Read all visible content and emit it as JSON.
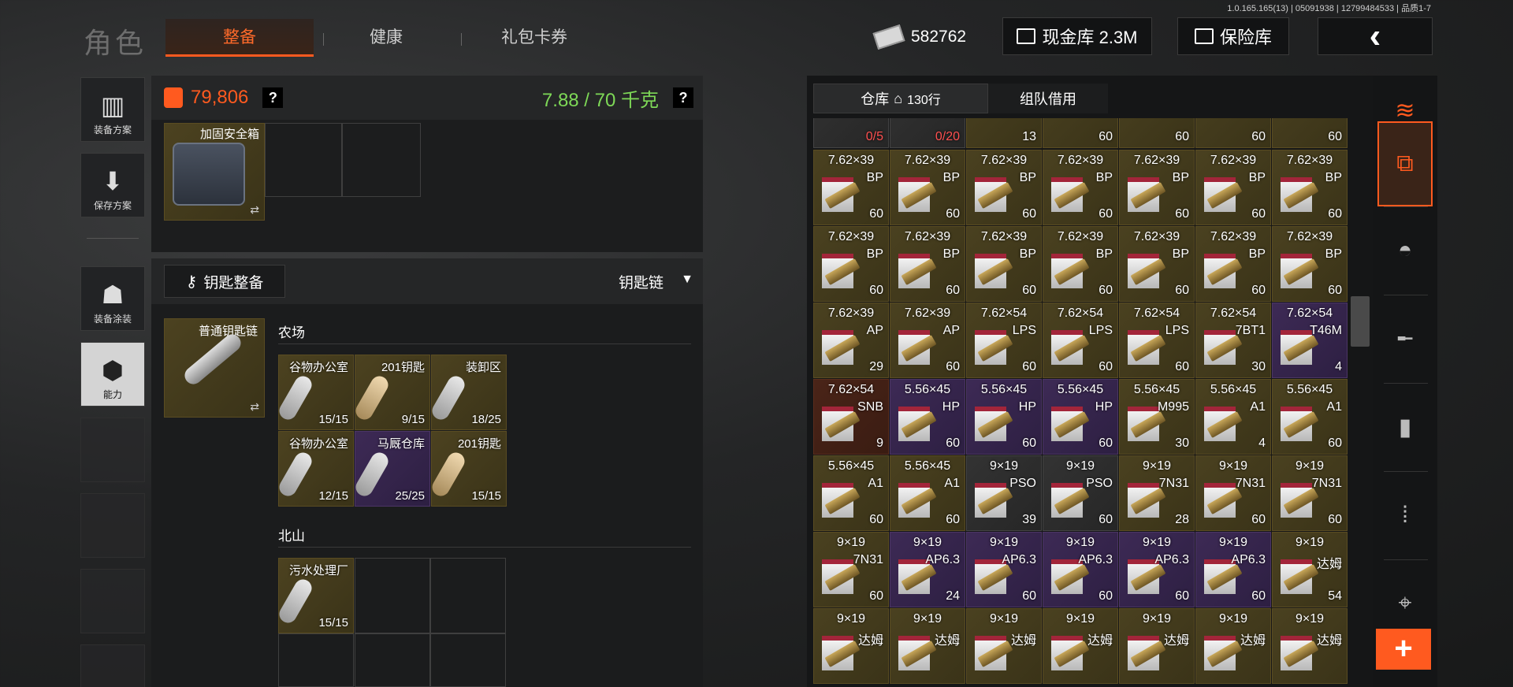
{
  "version": "1.0.165.165(13) | 05091938 | 12799484533 | 品质1-7",
  "title": "角色",
  "tabs": [
    "整备",
    "健康",
    "礼包卡券"
  ],
  "money": "582762",
  "buttons": {
    "cash": "现金库 2.3M",
    "insurance": "保险库",
    "back": "‹"
  },
  "sidebar": [
    "装备方案",
    "保存方案",
    "装备涂装",
    "能力"
  ],
  "loadout": {
    "value": "79,806",
    "help": "?",
    "weight": "7.88 / 70 千克"
  },
  "secure_case": {
    "name": "加固安全箱",
    "swap": "⇄"
  },
  "keys": {
    "tab": "钥匙整备",
    "filter": "钥匙链",
    "ring": "普通钥匙链",
    "farm": "农场",
    "north": "北山"
  },
  "farm_keys": [
    {
      "name": "谷物办公室",
      "count": "15/15",
      "tone": "olive"
    },
    {
      "name": "201钥匙",
      "count": "9/15",
      "tone": "olive"
    },
    {
      "name": "装卸区",
      "count": "18/25",
      "tone": "olive"
    },
    {
      "name": "谷物办公室",
      "count": "12/15",
      "tone": "olive"
    },
    {
      "name": "马厩仓库",
      "count": "25/25",
      "tone": "purple"
    },
    {
      "name": "201钥匙",
      "count": "15/15",
      "tone": "olive"
    }
  ],
  "north_keys": [
    {
      "name": "污水处理厂",
      "count": "15/15"
    }
  ],
  "inventory": {
    "tab": "仓库",
    "rows": "130行",
    "team": "组队借用"
  },
  "inv_top": [
    {
      "n": "0/5",
      "t": "gray"
    },
    {
      "n": "0/20",
      "t": "gray"
    },
    {
      "n": "13",
      "t": "olive"
    },
    {
      "n": "60",
      "t": "olive"
    },
    {
      "n": "60",
      "t": "olive"
    },
    {
      "n": "60",
      "t": "olive"
    },
    {
      "n": "60",
      "t": "olive"
    }
  ],
  "inv_rows": [
    [
      {
        "c": "7.62×39",
        "s": "BP",
        "n": "60",
        "t": "olive"
      },
      {
        "c": "7.62×39",
        "s": "BP",
        "n": "60",
        "t": "olive"
      },
      {
        "c": "7.62×39",
        "s": "BP",
        "n": "60",
        "t": "olive"
      },
      {
        "c": "7.62×39",
        "s": "BP",
        "n": "60",
        "t": "olive"
      },
      {
        "c": "7.62×39",
        "s": "BP",
        "n": "60",
        "t": "olive"
      },
      {
        "c": "7.62×39",
        "s": "BP",
        "n": "60",
        "t": "olive"
      },
      {
        "c": "7.62×39",
        "s": "BP",
        "n": "60",
        "t": "olive"
      }
    ],
    [
      {
        "c": "7.62×39",
        "s": "BP",
        "n": "60",
        "t": "olive"
      },
      {
        "c": "7.62×39",
        "s": "BP",
        "n": "60",
        "t": "olive"
      },
      {
        "c": "7.62×39",
        "s": "BP",
        "n": "60",
        "t": "olive"
      },
      {
        "c": "7.62×39",
        "s": "BP",
        "n": "60",
        "t": "olive"
      },
      {
        "c": "7.62×39",
        "s": "BP",
        "n": "60",
        "t": "olive"
      },
      {
        "c": "7.62×39",
        "s": "BP",
        "n": "60",
        "t": "olive"
      },
      {
        "c": "7.62×39",
        "s": "BP",
        "n": "60",
        "t": "olive"
      }
    ],
    [
      {
        "c": "7.62×39",
        "s": "AP",
        "n": "29",
        "t": "olive"
      },
      {
        "c": "7.62×39",
        "s": "AP",
        "n": "60",
        "t": "olive"
      },
      {
        "c": "7.62×54",
        "s": "LPS",
        "n": "60",
        "t": "olive"
      },
      {
        "c": "7.62×54",
        "s": "LPS",
        "n": "60",
        "t": "olive"
      },
      {
        "c": "7.62×54",
        "s": "LPS",
        "n": "60",
        "t": "olive"
      },
      {
        "c": "7.62×54",
        "s": "7BT1",
        "n": "30",
        "t": "olive"
      },
      {
        "c": "7.62×54",
        "s": "T46M",
        "n": "4",
        "t": "pur"
      }
    ],
    [
      {
        "c": "7.62×54",
        "s": "SNB",
        "n": "9",
        "t": "red"
      },
      {
        "c": "5.56×45",
        "s": "HP",
        "n": "60",
        "t": "pur"
      },
      {
        "c": "5.56×45",
        "s": "HP",
        "n": "60",
        "t": "pur"
      },
      {
        "c": "5.56×45",
        "s": "HP",
        "n": "60",
        "t": "pur"
      },
      {
        "c": "5.56×45",
        "s": "M995",
        "n": "30",
        "t": "olive"
      },
      {
        "c": "5.56×45",
        "s": "A1",
        "n": "4",
        "t": "olive"
      },
      {
        "c": "5.56×45",
        "s": "A1",
        "n": "60",
        "t": "olive"
      }
    ],
    [
      {
        "c": "5.56×45",
        "s": "A1",
        "n": "60",
        "t": "olive"
      },
      {
        "c": "5.56×45",
        "s": "A1",
        "n": "60",
        "t": "olive"
      },
      {
        "c": "9×19",
        "s": "PSO",
        "n": "39",
        "t": "gray"
      },
      {
        "c": "9×19",
        "s": "PSO",
        "n": "60",
        "t": "gray"
      },
      {
        "c": "9×19",
        "s": "7N31",
        "n": "28",
        "t": "olive"
      },
      {
        "c": "9×19",
        "s": "7N31",
        "n": "60",
        "t": "olive"
      },
      {
        "c": "9×19",
        "s": "7N31",
        "n": "60",
        "t": "olive"
      }
    ],
    [
      {
        "c": "9×19",
        "s": "7N31",
        "n": "60",
        "t": "olive"
      },
      {
        "c": "9×19",
        "s": "AP6.3",
        "n": "24",
        "t": "pur"
      },
      {
        "c": "9×19",
        "s": "AP6.3",
        "n": "60",
        "t": "pur"
      },
      {
        "c": "9×19",
        "s": "AP6.3",
        "n": "60",
        "t": "pur"
      },
      {
        "c": "9×19",
        "s": "AP6.3",
        "n": "60",
        "t": "pur"
      },
      {
        "c": "9×19",
        "s": "AP6.3",
        "n": "60",
        "t": "pur"
      },
      {
        "c": "9×19",
        "s": "达姆",
        "n": "54",
        "t": "olive"
      }
    ],
    [
      {
        "c": "9×19",
        "s": "达姆",
        "n": "",
        "t": "olive"
      },
      {
        "c": "9×19",
        "s": "达姆",
        "n": "",
        "t": "olive"
      },
      {
        "c": "9×19",
        "s": "达姆",
        "n": "",
        "t": "olive"
      },
      {
        "c": "9×19",
        "s": "达姆",
        "n": "",
        "t": "olive"
      },
      {
        "c": "9×19",
        "s": "达姆",
        "n": "",
        "t": "olive"
      },
      {
        "c": "9×19",
        "s": "达姆",
        "n": "",
        "t": "olive"
      },
      {
        "c": "9×19",
        "s": "达姆",
        "n": "",
        "t": "olive"
      }
    ]
  ],
  "rail": {
    "add": "+"
  }
}
